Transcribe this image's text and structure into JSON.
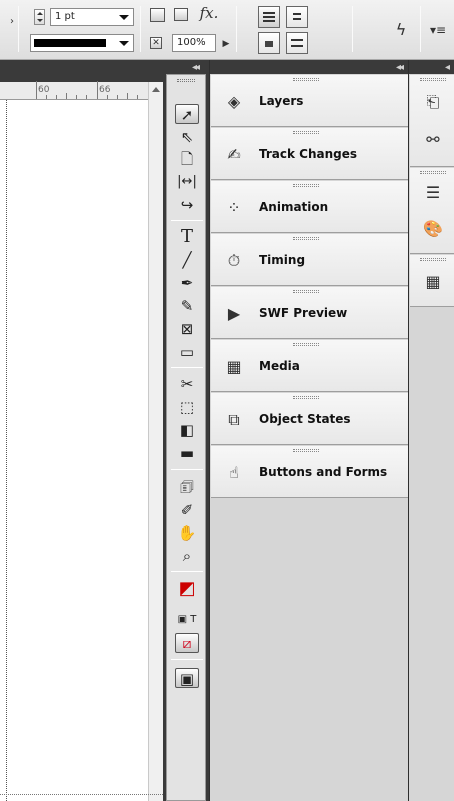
{
  "control_bar": {
    "stroke_weight": {
      "value": "1 pt",
      "icon": "spinner-icon"
    },
    "stroke_type": {
      "swatch_color": "#000000"
    },
    "opacity": {
      "value": "100%"
    },
    "fx_label": "fx."
  },
  "ruler": {
    "marks": [
      "60",
      "66"
    ]
  },
  "panels": [
    {
      "label": "Layers",
      "icon": "layers-icon"
    },
    {
      "label": "Track Changes",
      "icon": "track-changes-icon"
    },
    {
      "label": "Animation",
      "icon": "animation-icon"
    },
    {
      "label": "Timing",
      "icon": "timing-icon"
    },
    {
      "label": "SWF Preview",
      "icon": "swf-preview-icon"
    },
    {
      "label": "Media",
      "icon": "media-icon"
    },
    {
      "label": "Object States",
      "icon": "object-states-icon"
    },
    {
      "label": "Buttons and Forms",
      "icon": "buttons-and-forms-icon"
    }
  ],
  "tools": [
    "selection-tool",
    "direct-selection-tool",
    "page-tool",
    "gap-tool",
    "content-collector-tool",
    "type-tool",
    "line-tool",
    "pen-tool",
    "pencil-tool",
    "rectangle-frame-tool",
    "rectangle-tool",
    "scissors-tool",
    "free-transform-tool",
    "gradient-swatch-tool",
    "gradient-feather-tool",
    "note-tool",
    "eyedropper-tool",
    "hand-tool",
    "zoom-tool",
    "fill-stroke-swatch",
    "apply-color",
    "apply-none",
    "screen-mode"
  ],
  "colors": {
    "dock_header": "#3a3a3a",
    "panel_bg": "#d6d6d6",
    "apply_none_red": "#d0021b"
  }
}
